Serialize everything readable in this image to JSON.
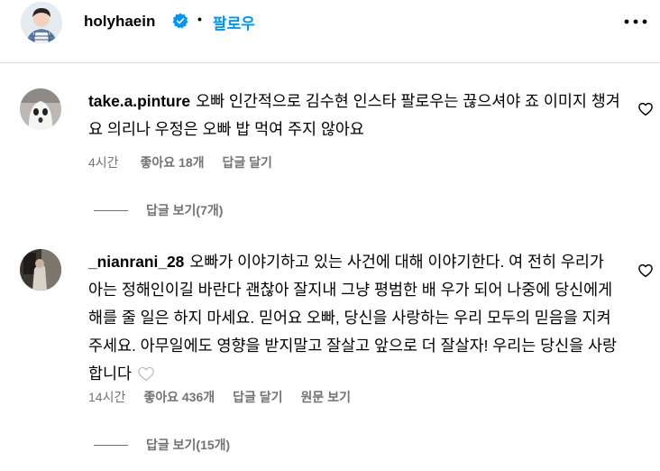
{
  "header": {
    "username": "holyhaein",
    "separator": "•",
    "follow_label": "팔로우"
  },
  "comments": [
    {
      "username": "take.a.pinture",
      "text": "오빠 인간적으로 김수현 인스타 팔로우는 끊으셔야 죠 이미지 챙겨요 의리나 우정은 오빠 밥 먹여 주지 않아요",
      "time": "4시간",
      "likes": "좋아요 18개",
      "reply_label": "답글 달기",
      "view_replies": "답글 보기(7개)"
    },
    {
      "username": "_nianrani_28",
      "text": "오빠가 이야기하고 있는 사건에 대해 이야기한다. 여 전히 우리가 아는 정해인이길 바란다 괜찮아 잘지내 그냥 평범한 배 우가 되어 나중에 당신에게 해를 줄 일은 하지 마세요. 믿어요 오빠, 당신을 사랑하는 우리 모두의 믿음을 지켜주세요. 아무일에도 영향을 받지말고 잘살고 앞으로 더 잘살자! 우리는 당신을 사랑합니다",
      "time": "14시간",
      "likes": "좋아요 436개",
      "reply_label": "답글 달기",
      "translate_label": "원문 보기",
      "view_replies": "답글 보기(15개)"
    }
  ],
  "colors": {
    "accent": "#0095f6",
    "secondary_text": "#737373",
    "divider": "#dbdbdb"
  },
  "icons": [
    "verified-badge-icon",
    "more-options-icon",
    "heart-icon"
  ]
}
